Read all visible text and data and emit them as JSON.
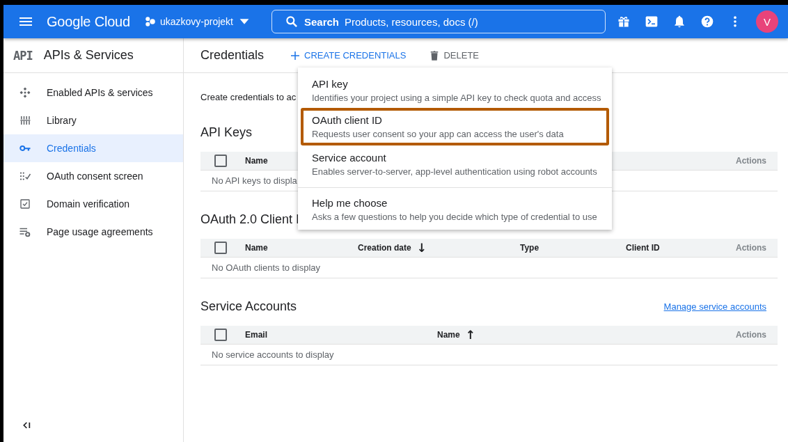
{
  "header": {
    "logo": "Google Cloud",
    "project": "ukazkovy-projekt",
    "search": {
      "label": "Search",
      "placeholder": "Products, resources, docs (/)"
    },
    "actions": [
      {
        "kind": "gift"
      },
      {
        "kind": "terminal"
      },
      {
        "kind": "bell"
      },
      {
        "kind": "help"
      },
      {
        "kind": "more"
      }
    ],
    "avatar": "V"
  },
  "sidebar": {
    "badge": "API",
    "title": "APIs & Services",
    "items": [
      {
        "label": "Enabled APIs & services",
        "selected": false
      },
      {
        "label": "Library",
        "selected": false
      },
      {
        "label": "Credentials",
        "selected": true
      },
      {
        "label": "OAuth consent screen",
        "selected": false
      },
      {
        "label": "Domain verification",
        "selected": false
      },
      {
        "label": "Page usage agreements",
        "selected": false
      }
    ]
  },
  "toolbar": {
    "title": "Credentials",
    "buttons": [
      {
        "label": "CREATE CREDENTIALS",
        "kind": "create"
      },
      {
        "label": "DELETE",
        "kind": "delete"
      }
    ]
  },
  "intro": "Create credentials to ac",
  "sections": [
    {
      "kind": "api",
      "title": "API Keys",
      "select_all": {
        "checked": false
      },
      "columns": [
        {
          "label": "Name"
        },
        {
          "label": "Actions"
        }
      ],
      "empty": "No API keys to displa"
    },
    {
      "kind": "oauth",
      "title": "OAuth 2.0 Client I",
      "select_all": {
        "checked": false
      },
      "columns": [
        {
          "label": "Name"
        },
        {
          "label": "Creation date",
          "sort_arrow": "↓"
        },
        {
          "label": "Type"
        },
        {
          "label": "Client ID"
        },
        {
          "label": "Actions"
        }
      ],
      "empty": "No OAuth clients to display"
    },
    {
      "kind": "service",
      "title": "Service Accounts",
      "link": "Manage service accounts",
      "select_all": {
        "checked": false
      },
      "columns": [
        {
          "label": "Email"
        },
        {
          "label": "Name",
          "sort_arrow": "↑"
        },
        {
          "label": "Actions"
        }
      ],
      "empty": "No service accounts to display"
    }
  ],
  "menu": {
    "items": [
      {
        "title": "API key",
        "description": "Identifies your project using a simple API key to check quota and access",
        "highlighted": false,
        "separated": false
      },
      {
        "title": "OAuth client ID",
        "description": "Requests user consent so your app can access the user's data",
        "highlighted": true,
        "separated": false
      },
      {
        "title": "Service account",
        "description": "Enables server-to-server, app-level authentication using robot accounts",
        "highlighted": false,
        "separated": false
      },
      {
        "title": "Help me choose",
        "description": "Asks a few questions to help you decide which type of credential to use",
        "highlighted": false,
        "separated": true
      }
    ]
  }
}
